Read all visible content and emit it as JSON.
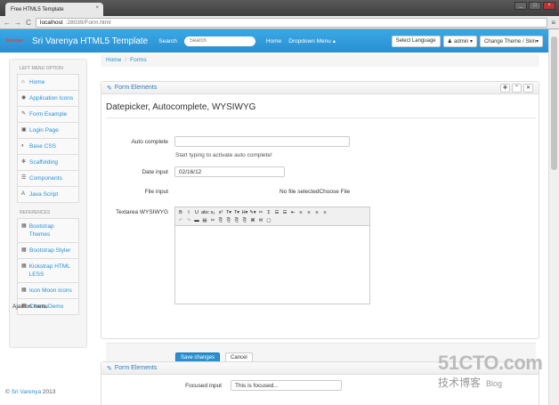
{
  "browser": {
    "tab_title": "Free HTML5 Template",
    "tab_close": "×",
    "url_host": "localhost",
    "url_path": ":28039/Form.html",
    "back": "←",
    "forward": "→",
    "reload": "C",
    "menu": "≡",
    "win_min": "_",
    "win_max": "□",
    "win_close": "×"
  },
  "navbar": {
    "brand_logo": "Varenya",
    "brand": "Sri Varenya HTML5 Template",
    "search_label": "Search",
    "search_placeholder": "Search",
    "links": [
      "Home",
      "Dropdown Menu ▴"
    ],
    "language_select": "Select Language",
    "admin_button": "admin ▾",
    "theme_button": "Change Theme / Skin▾"
  },
  "sidebar": {
    "header_main": "LEFT MENU OPTION",
    "items": [
      {
        "label": "Home",
        "icon": "home-icon",
        "glyph": "⌂"
      },
      {
        "label": "Application Icons",
        "icon": "globe-icon",
        "glyph": "◉"
      },
      {
        "label": "Form Example",
        "icon": "edit-icon",
        "glyph": "✎"
      },
      {
        "label": "Login Page",
        "icon": "lock-icon",
        "glyph": "▣"
      },
      {
        "label": "Base CSS",
        "icon": "eye-icon",
        "glyph": "◐"
      },
      {
        "label": "Scaffolding",
        "icon": "gear-icon",
        "glyph": "✻"
      },
      {
        "label": "Components",
        "icon": "list-icon",
        "glyph": "☰"
      },
      {
        "label": "Java Script",
        "icon": "font-icon",
        "glyph": "A"
      }
    ],
    "header_refs": "REFERENCES",
    "refs": [
      {
        "label": "Bootstrap Themes",
        "icon": "grid-icon",
        "glyph": "▦"
      },
      {
        "label": "Bootstrap Styler",
        "icon": "grid-icon",
        "glyph": "▦"
      },
      {
        "label": "Kickstrap HTML LESS",
        "icon": "grid-icon",
        "glyph": "▦"
      },
      {
        "label": "Icon Moon Icons",
        "icon": "grid-icon",
        "glyph": "▦"
      },
      {
        "label": "Charts Demo",
        "icon": "grid-icon",
        "glyph": "▦"
      }
    ],
    "ajax_label": "Ajax on menu"
  },
  "footer": {
    "copyright": "© ",
    "author": "Sri Varenya",
    "year": " 2013"
  },
  "breadcrumb": {
    "items": [
      "Home",
      "Forms"
    ],
    "separator": "/"
  },
  "box": {
    "title": "Form Elements",
    "title_icon": "✎",
    "tool_gear": "✻",
    "tool_chevron": "⌃",
    "tool_close": "✕",
    "section_title": "Datepicker, Autocomplete, WYSIWYG",
    "autocomplete_label": "Auto complete",
    "autocomplete_value": "",
    "autocomplete_help": "Start typing to activate auto complete!",
    "date_label": "Date input",
    "date_value": "02/16/12",
    "file_label": "File input",
    "file_text": "No file selectedChoose File",
    "textarea_label": "Textarea WYSIWYG",
    "toolbar_row1": [
      "B",
      "I",
      "U",
      "abc",
      "x₂",
      "x²",
      "T▾",
      "T▾",
      "H▾",
      "✎▾",
      "✂",
      "Σ",
      "☰",
      "☰",
      "⇤",
      "≡",
      "≡",
      "≡",
      "≡"
    ],
    "toolbar_row2": [
      "↶",
      "↷",
      "▬",
      "▤",
      "✂",
      "⎘",
      "⎘",
      "⎘",
      "⎘",
      "⌘",
      "✉",
      "▢"
    ],
    "save_button": "Save changes",
    "cancel_button": "Cancel"
  },
  "box2": {
    "title": "Form Elements",
    "title_icon": "✎",
    "focused_label": "Focused input",
    "focused_value": "This is focused..."
  },
  "watermark": {
    "main": "51CTO.com",
    "sub": "技术博客",
    "blog": "Blog"
  }
}
